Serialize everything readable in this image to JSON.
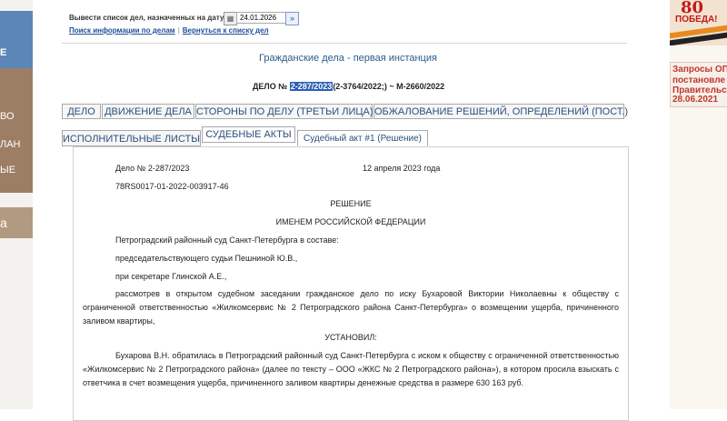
{
  "left_sidebar": {
    "blue_item": "Е",
    "brown_items": [
      "ВО",
      "ЛАН",
      "ЫЕ"
    ],
    "tan_item": "а"
  },
  "right_sidebar": {
    "banner_big": "80",
    "banner_word": "ПОБЕДА!",
    "news_lines": [
      "Запросы ОП",
      "постановле",
      "Правительс",
      "28.06.2021"
    ]
  },
  "date_filter": {
    "label": "Вывести список дел, назначенных на дату",
    "calendar_icon": "calendar-icon",
    "date_value": "24.01.2026",
    "go_icon": "double-chevron-right-icon"
  },
  "links": {
    "search": "Поиск информации по делам",
    "separator": "|",
    "back": "Вернуться к списку дел"
  },
  "section_title": "Гражданские дела - первая инстанция",
  "case": {
    "prefix": "ДЕЛО № ",
    "number_highlighted": "2-287/2023",
    "suffix": "(2-3764/2022;) ~ М-2660/2022"
  },
  "tabs_row1": [
    "ДЕЛО",
    "ДВИЖЕНИЕ ДЕЛА",
    "СТОРОНЫ ПО ДЕЛУ (ТРЕТЬИ ЛИЦА)",
    "ОБЖАЛОВАНИЕ РЕШЕНИЙ, ОПРЕДЕЛЕНИЙ (ПОСТ.)"
  ],
  "tabs_row2": [
    "ИСПОЛНИТЕЛЬНЫЕ ЛИСТЫ",
    "СУДЕБНЫЕ АКТЫ"
  ],
  "subtab": "Судебный акт #1 (Решение)",
  "document": {
    "case_no": "Дело № 2-287/2023",
    "date": "12 апреля 2023 года",
    "uid": "78RS0017-01-2022-003917-46",
    "heading1": "РЕШЕНИЕ",
    "heading2": "ИМЕНЕМ РОССИЙСКОЙ ФЕДЕРАЦИИ",
    "court": "Петроградский районный суд Санкт-Петербурга в составе:",
    "judge": "председательствующего судьи Пешниной Ю.В.,",
    "secretary": "при секретаре Глинской А.Е.,",
    "para1": "рассмотрев в открытом судебном заседании гражданское дело по иску Бухаровой Виктории Николаевны к обществу с ограниченной ответственностью «Жилкомсервис № 2 Петроградского района Санкт-Петербурга» о возмещении ущерба, причиненного заливом квартиры,",
    "established": "УСТАНОВИЛ:",
    "para2": "Бухарова В.Н. обратилась в Петроградский районный суд Санкт-Петербурга с иском к обществу с ограниченной ответственностью «Жилкомсервис № 2 Петроградского района» (далее по тексту – ООО «ЖКС № 2 Петроградского района»), в котором просила взыскать с ответчика в счет возмещения ущерба, причиненного заливом квартиры денежные средства в размере 630 163 руб."
  }
}
